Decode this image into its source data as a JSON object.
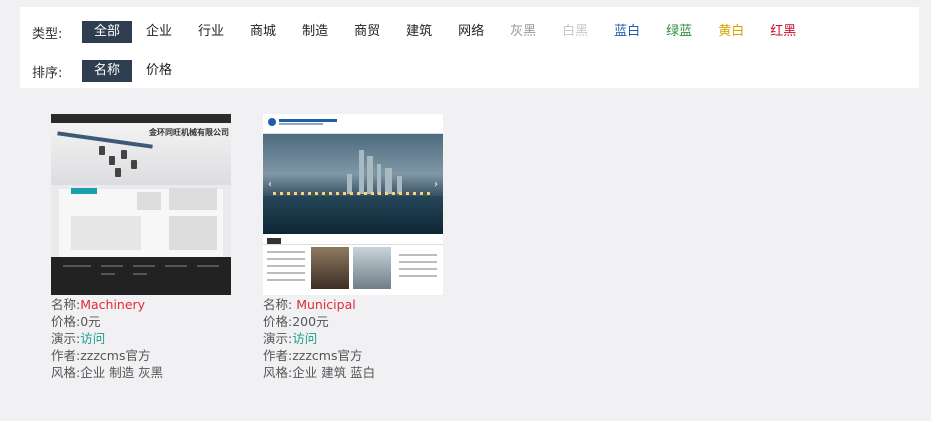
{
  "filters": {
    "type": {
      "label": "类型:",
      "options": [
        {
          "label": "全部",
          "active": true,
          "color": "#ffffff"
        },
        {
          "label": "企业",
          "active": false,
          "color": "#222222"
        },
        {
          "label": "行业",
          "active": false,
          "color": "#222222"
        },
        {
          "label": "商城",
          "active": false,
          "color": "#222222"
        },
        {
          "label": "制造",
          "active": false,
          "color": "#222222"
        },
        {
          "label": "商贸",
          "active": false,
          "color": "#222222"
        },
        {
          "label": "建筑",
          "active": false,
          "color": "#222222"
        },
        {
          "label": "网络",
          "active": false,
          "color": "#222222"
        },
        {
          "label": "灰黑",
          "active": false,
          "color": "#999999"
        },
        {
          "label": "白黑",
          "active": false,
          "color": "#c8c8c8"
        },
        {
          "label": "蓝白",
          "active": false,
          "color": "#1f5fa8"
        },
        {
          "label": "绿蓝",
          "active": false,
          "color": "#2e8b3a"
        },
        {
          "label": "黄白",
          "active": false,
          "color": "#d8a300"
        },
        {
          "label": "红黑",
          "active": false,
          "color": "#c8102e"
        }
      ]
    },
    "sort": {
      "label": "排序:",
      "options": [
        {
          "label": "名称",
          "active": true
        },
        {
          "label": "价格",
          "active": false
        }
      ]
    }
  },
  "templates": [
    {
      "thumb_icon": "machinery-thumbnail",
      "thumb_title": "金环同旺机械有限公司",
      "name_label": "名称:",
      "name": "Machinery",
      "price_label": "价格:",
      "price": "0元",
      "demo_label": "演示:",
      "demo": "访问",
      "author_label": "作者:",
      "author": "zzzcms官方",
      "style_label": "风格:",
      "style": "企业 制造 灰黑"
    },
    {
      "thumb_icon": "municipal-thumbnail",
      "name_label": "名称: ",
      "name": "Municipal",
      "price_label": "价格:",
      "price": "200元",
      "demo_label": "演示:",
      "demo": "访问",
      "author_label": "作者:",
      "author": "zzzcms官方",
      "style_label": "风格:",
      "style": "企业 建筑 蓝白"
    }
  ],
  "colors": {
    "active_bg": "#2e3e50",
    "name_value": "#e02a3b",
    "link": "#1a9e8a"
  }
}
